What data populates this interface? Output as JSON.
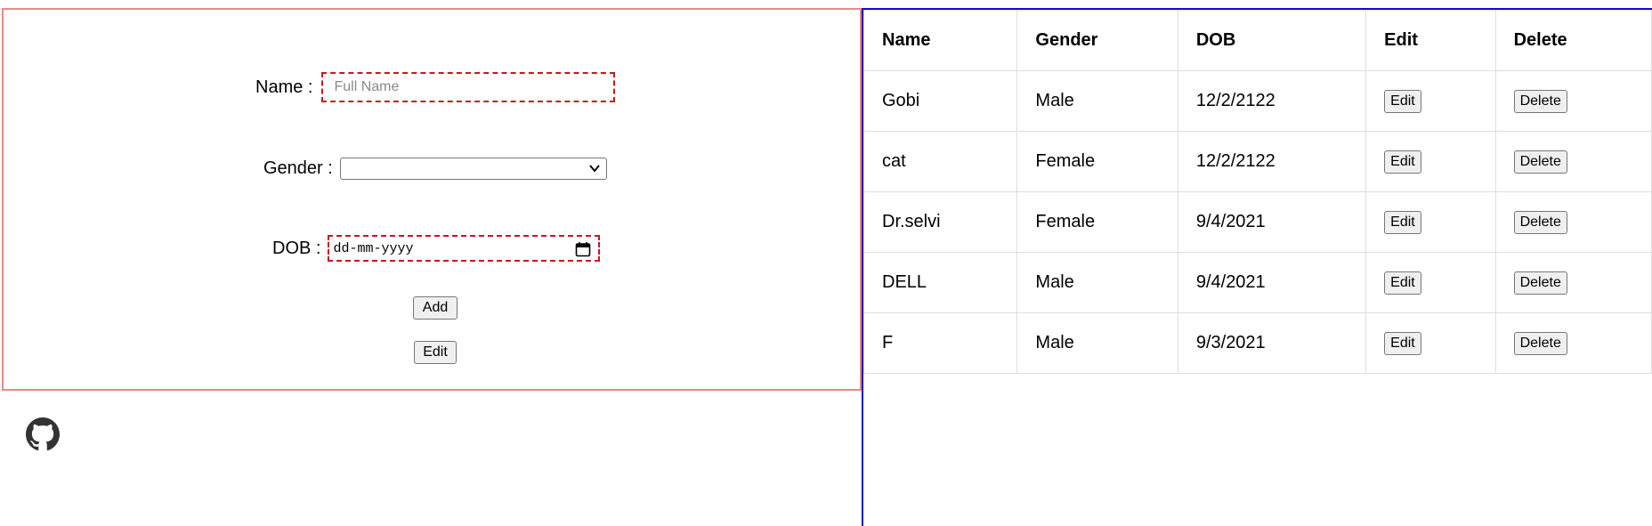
{
  "form": {
    "name_label": "Name :",
    "name_placeholder": "Full Name",
    "name_value": "",
    "gender_label": "Gender :",
    "gender_selected": "",
    "dob_label": "DOB :",
    "dob_placeholder": "dd-mm-yyyy",
    "add_label": "Add",
    "edit_label": "Edit"
  },
  "icons": {
    "github": "github-icon",
    "calendar": "calendar-icon",
    "chevron": "chevron-down-icon"
  },
  "colors": {
    "form_border": "#e88a84",
    "input_dashed_border": "#c8161d",
    "table_border": "#1010c8"
  },
  "table": {
    "headers": [
      "Name",
      "Gender",
      "DOB",
      "Edit",
      "Delete"
    ],
    "edit_label": "Edit",
    "delete_label": "Delete",
    "rows": [
      {
        "name": "Gobi",
        "gender": "Male",
        "dob": "12/2/2122"
      },
      {
        "name": "cat",
        "gender": "Female",
        "dob": "12/2/2122"
      },
      {
        "name": "Dr.selvi",
        "gender": "Female",
        "dob": "9/4/2021"
      },
      {
        "name": "DELL",
        "gender": "Male",
        "dob": "9/4/2021"
      },
      {
        "name": "F",
        "gender": "Male",
        "dob": "9/3/2021"
      }
    ]
  }
}
